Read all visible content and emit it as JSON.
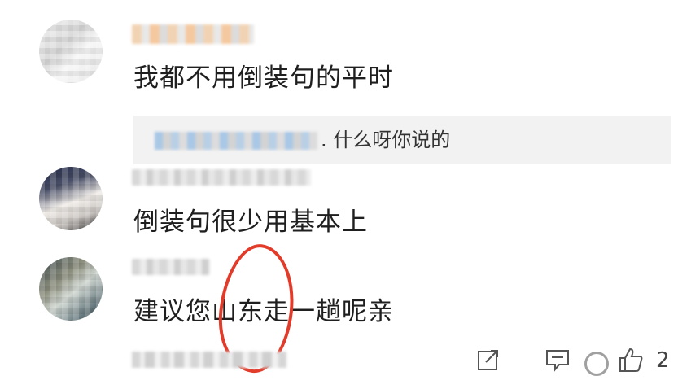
{
  "comments": [
    {
      "content": "我都不用倒装句的平时"
    },
    {
      "content": "倒装句很少用基本上"
    },
    {
      "content": "建议您山东走一趟呢亲"
    }
  ],
  "reply": {
    "text": ". 什么呀你说的"
  },
  "actions": {
    "like_count": "2"
  },
  "colors": {
    "annotation": "#e23b2a",
    "reply_bg": "#f2f2f2",
    "icon": "#555555"
  }
}
